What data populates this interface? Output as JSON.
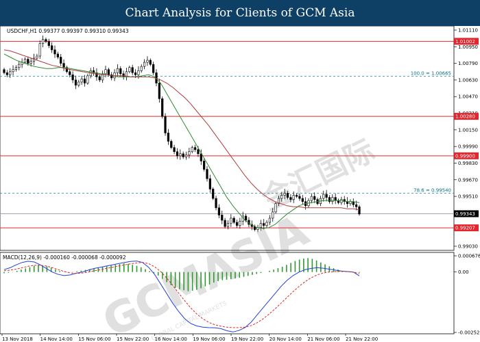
{
  "header": {
    "title": "Chart Analysis for Clients of GCM Asia"
  },
  "watermark": {
    "brand": "GCMASIA",
    "chinese": "金汇国际",
    "sub": "GLOBAL CAPITAL MARKETS"
  },
  "colors": {
    "banner": "#0e3f64",
    "support_resistance": "#e3262d",
    "fib": "#1a8a9e",
    "ma_fast": "#2e8b2e",
    "ma_slow": "#b23a3a",
    "macd_hist": "#2e9a2e",
    "macd_line": "#1f3fd6",
    "signal_line": "#e02424",
    "price_line": "#8a9aa8",
    "candles": "#000000"
  },
  "chart_data": [
    {
      "type": "candlestick",
      "symbol_info": "USDCHF,H1  0.99377 0.99397 0.99310 0.99343",
      "ylim": [
        0.9903,
        1.0111
      ],
      "y_ticks": [
        1.0111,
        1.0095,
        1.0079,
        1.0063,
        1.0047,
        1.0031,
        1.0015,
        0.9999,
        0.9983,
        0.9967,
        0.9951,
        0.9935,
        0.9919,
        0.9903
      ],
      "x_ticks": [
        "13 Nov 2018",
        "14 Nov 14:00",
        "15 Nov 06:00",
        "15 Nov 22:00",
        "16 Nov 14:00",
        "19 Nov 06:00",
        "19 Nov 22:00",
        "20 Nov 14:00",
        "21 Nov 06:00",
        "21 Nov 22:00"
      ],
      "horizontal_levels": [
        {
          "value": 1.01002,
          "label": "1.01002",
          "kind": "resistance"
        },
        {
          "value": 1.0028,
          "label": "1.00280",
          "kind": "resistance"
        },
        {
          "value": 0.999,
          "label": "0.99900",
          "kind": "resistance"
        },
        {
          "value": 0.99207,
          "label": "0.99207",
          "kind": "support"
        }
      ],
      "current_price": {
        "value": 0.99343,
        "label": "0.99343"
      },
      "fib_levels": [
        {
          "value": 1.00665,
          "label": "100.0 = 1.00665"
        },
        {
          "value": 0.9954,
          "label": "78.6 = 0.99540"
        }
      ],
      "closes": [
        1.007,
        1.0068,
        1.0071,
        1.0073,
        1.0075,
        1.0078,
        1.008,
        1.0083,
        1.0079,
        1.0081,
        1.0084,
        1.0086,
        1.0098,
        1.0102,
        1.01,
        1.0096,
        1.0092,
        1.0088,
        1.0085,
        1.0079,
        1.0075,
        1.0071,
        1.0068,
        1.0063,
        1.0058,
        1.0061,
        1.0064,
        1.006,
        1.0067,
        1.0072,
        1.007,
        1.0066,
        1.0063,
        1.0069,
        1.0073,
        1.0068,
        1.0065,
        1.007,
        1.0074,
        1.0069,
        1.0066,
        1.0071,
        1.0075,
        1.007,
        1.0068,
        1.0072,
        1.0076,
        1.008,
        1.0082,
        1.0078,
        1.007,
        1.006,
        1.0045,
        1.0028,
        1.0012,
        1.0004,
        0.9998,
        0.9994,
        0.999,
        0.9992,
        0.9989,
        0.9991,
        0.9994,
        0.9998,
        0.9996,
        0.9992,
        0.9985,
        0.9977,
        0.9968,
        0.9958,
        0.9949,
        0.994,
        0.9933,
        0.9928,
        0.9922,
        0.9925,
        0.993,
        0.9926,
        0.9923,
        0.9927,
        0.9932,
        0.9928,
        0.9924,
        0.9922,
        0.9919,
        0.9921,
        0.9925,
        0.9923,
        0.9926,
        0.993,
        0.9936,
        0.9944,
        0.9949,
        0.9952,
        0.9954,
        0.995,
        0.9948,
        0.9952,
        0.9951,
        0.9949,
        0.9946,
        0.9942,
        0.9947,
        0.9951,
        0.9948,
        0.9944,
        0.9949,
        0.9953,
        0.995,
        0.9946,
        0.995,
        0.9947,
        0.9945,
        0.9948,
        0.9946,
        0.9944,
        0.9946,
        0.9943,
        0.9941,
        0.9934
      ],
      "ma_fast": [
        1.0088,
        1.0085,
        1.0082,
        1.008,
        1.0078,
        1.0076,
        1.0075,
        1.0074,
        1.0074,
        1.0075,
        1.0075,
        1.0074,
        1.0073,
        1.0072,
        1.0071,
        1.007,
        1.0069,
        1.0068,
        1.0067,
        1.0066,
        1.0066,
        1.0066,
        1.0066,
        1.0067,
        1.0068,
        1.0066,
        1.006,
        1.005,
        1.004,
        1.003,
        1.002,
        1.001,
        1.0,
        0.999,
        0.998,
        0.997,
        0.996,
        0.995,
        0.9942,
        0.9935,
        0.9928,
        0.9924,
        0.9921,
        0.992,
        0.9921,
        0.9924,
        0.9929,
        0.9934,
        0.9938,
        0.9942,
        0.9944,
        0.9945,
        0.9946,
        0.9947,
        0.9947,
        0.9947,
        0.9947,
        0.9946,
        0.9946,
        0.9945
      ],
      "ma_slow": [
        1.0092,
        1.0091,
        1.0089,
        1.0087,
        1.0085,
        1.0083,
        1.0081,
        1.0079,
        1.0077,
        1.0076,
        1.0074,
        1.0073,
        1.0072,
        1.0071,
        1.007,
        1.0069,
        1.0068,
        1.0068,
        1.0067,
        1.0067,
        1.0067,
        1.0066,
        1.0066,
        1.0066,
        1.0066,
        1.0065,
        1.0063,
        1.006,
        1.0056,
        1.0051,
        1.0046,
        1.004,
        1.0033,
        1.0026,
        1.0019,
        1.0011,
        1.0003,
        0.9995,
        0.9987,
        0.9979,
        0.9971,
        0.9964,
        0.9958,
        0.9953,
        0.9949,
        0.9946,
        0.9944,
        0.9942,
        0.9941,
        0.9941,
        0.994,
        0.994,
        0.994,
        0.994,
        0.994,
        0.994,
        0.994,
        0.9939,
        0.9939,
        0.9938
      ]
    },
    {
      "type": "macd",
      "title": "MACD(12,26,9) -0.000160 -0.000068 -0.000092",
      "ylim": [
        -0.002521,
        0.000676
      ],
      "y_ticks": [
        0.000676,
        0.0,
        -0.002521
      ],
      "y_tick_labels": [
        "0.000676",
        "0.00",
        "-0.002521"
      ],
      "histogram": [
        -5e-05,
        -3e-05,
        1e-05,
        5e-05,
        0.0001,
        0.00015,
        0.0002,
        0.00026,
        0.0003,
        0.00028,
        0.00024,
        0.00018,
        0.0001,
        4e-05,
        1e-05,
        -2e-05,
        -1e-05,
        3e-05,
        6e-05,
        9e-05,
        0.00012,
        0.00015,
        0.00018,
        0.00021,
        0.00024,
        0.00027,
        0.0003,
        0.00033,
        0.00036,
        0.00034,
        0.0003,
        0.00026,
        0.0002,
        0.00012,
        4e-05,
        -5e-05,
        -0.00015,
        -0.00028,
        -0.00042,
        -0.00055,
        -0.00066,
        -0.00072,
        -0.00076,
        -0.0008,
        -0.00078,
        -0.00074,
        -0.00068,
        -0.0006,
        -0.00052,
        -0.00044,
        -0.00038,
        -0.00034,
        -0.00032,
        -0.0003,
        -0.00027,
        -0.00024,
        -0.0002,
        -0.00016,
        -0.00012,
        -8e-05,
        -4e-05,
        0.0,
        5e-05,
        0.0001,
        0.00016,
        0.00022,
        0.0003,
        0.00038,
        0.00046,
        0.00052,
        0.00056,
        0.00058,
        0.00055,
        0.00048,
        0.0004,
        0.00032,
        0.00024,
        0.00016,
        0.0001,
        5e-05,
        2e-05,
        -1e-05,
        -2e-05,
        -3e-05
      ],
      "macd": [
        0.0001,
        0.00018,
        0.0003,
        0.0004,
        0.00045,
        0.00042,
        0.0003,
        0.00015,
        0.0,
        -0.0001,
        -0.00015,
        -0.00012,
        -5e-05,
        0.0,
        8e-05,
        0.00015,
        0.0002,
        0.00025,
        0.0003,
        0.00035,
        0.0004,
        0.00044,
        0.00046,
        0.0004,
        0.0002,
        -0.0001,
        -0.0005,
        -0.0009,
        -0.0013,
        -0.00165,
        -0.00195,
        -0.00215,
        -0.00225,
        -0.0023,
        -0.00232,
        -0.00233,
        -0.00236,
        -0.00245,
        -0.0025,
        -0.00244,
        -0.00232,
        -0.0021,
        -0.0018,
        -0.0015,
        -0.0012,
        -0.0009,
        -0.0006,
        -0.00035,
        -0.00015,
        0.0,
        0.0001,
        0.00015,
        0.00018,
        0.00016,
        0.00012,
        8e-05,
        4e-05,
        2e-05,
        0.0,
        -0.00016
      ],
      "signal": [
        5e-05,
        8e-05,
        0.00012,
        0.00018,
        0.00024,
        0.00028,
        0.00028,
        0.00025,
        0.00018,
        0.0001,
        2e-05,
        -4e-05,
        -6e-05,
        -4e-05,
        0.0,
        5e-05,
        0.0001,
        0.00015,
        0.0002,
        0.00025,
        0.0003,
        0.00034,
        0.00038,
        0.0004,
        0.00035,
        0.00022,
        2e-05,
        -0.00025,
        -0.00055,
        -0.00088,
        -0.0012,
        -0.0015,
        -0.00175,
        -0.00195,
        -0.0021,
        -0.0022,
        -0.00226,
        -0.0023,
        -0.00232,
        -0.00232,
        -0.0023,
        -0.00224,
        -0.00212,
        -0.00196,
        -0.00176,
        -0.00154,
        -0.0013,
        -0.00106,
        -0.00082,
        -0.0006,
        -0.0004,
        -0.00024,
        -0.00012,
        -4e-05,
        0.0,
        2e-05,
        3e-05,
        2e-05,
        0.0,
        -7e-05
      ]
    }
  ]
}
